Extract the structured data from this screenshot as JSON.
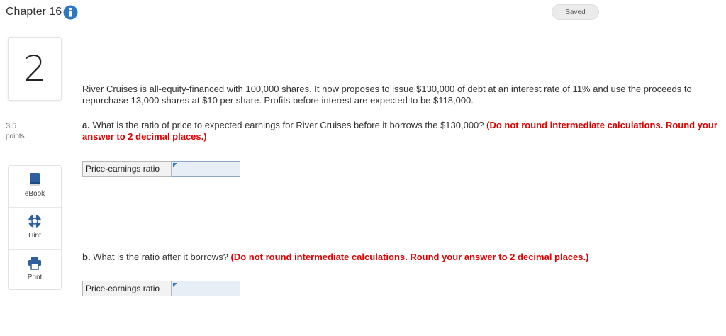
{
  "header": {
    "chapter": "Chapter 16",
    "info_icon": "info-circle-icon",
    "saved": "Saved"
  },
  "question": {
    "number": "2",
    "points_value": "3.5",
    "points_label": "points",
    "intro": "River Cruises is all-equity-financed with 100,000 shares. It now proposes to issue $130,000 of debt at an interest rate of 11% and use the proceeds to repurchase 13,000 shares at $10 per share. Profits before interest are expected to be $118,000.",
    "part_a": {
      "letter": "a.",
      "text": " What is the ratio of price to expected earnings for River Cruises before it borrows the $130,000? ",
      "instruction": "(Do not round intermediate calculations. Round your answer to 2 decimal places.)",
      "answer_label": "Price-earnings ratio",
      "answer_value": ""
    },
    "part_b": {
      "letter": "b.",
      "text": " What is the ratio after it borrows? ",
      "instruction": "(Do not round intermediate calculations. Round your answer to 2 decimal places.)",
      "answer_label": "Price-earnings ratio",
      "answer_value": ""
    }
  },
  "tools": [
    {
      "label": "eBook",
      "icon": "book-icon"
    },
    {
      "label": "Hint",
      "icon": "lifebuoy-icon"
    },
    {
      "label": "Print",
      "icon": "printer-icon"
    }
  ],
  "colors": {
    "accent": "#2e77c2",
    "instruction": "#e00000",
    "input_bg": "#e8eef5"
  }
}
